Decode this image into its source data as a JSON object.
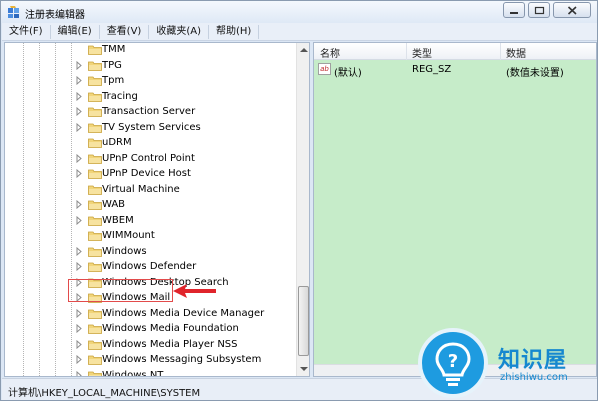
{
  "window": {
    "title": "注册表编辑器"
  },
  "menu": [
    "文件(F)",
    "编辑(E)",
    "查看(V)",
    "收藏夹(A)",
    "帮助(H)"
  ],
  "tree": {
    "items": [
      {
        "label": "TMM",
        "expander": false
      },
      {
        "label": "TPG",
        "expander": true
      },
      {
        "label": "Tpm",
        "expander": true
      },
      {
        "label": "Tracing",
        "expander": true
      },
      {
        "label": "Transaction Server",
        "expander": true
      },
      {
        "label": "TV System Services",
        "expander": true
      },
      {
        "label": "uDRM",
        "expander": false
      },
      {
        "label": "UPnP Control Point",
        "expander": true
      },
      {
        "label": "UPnP Device Host",
        "expander": true
      },
      {
        "label": "Virtual Machine",
        "expander": false
      },
      {
        "label": "WAB",
        "expander": true
      },
      {
        "label": "WBEM",
        "expander": true
      },
      {
        "label": "WIMMount",
        "expander": false
      },
      {
        "label": "Windows",
        "expander": true,
        "highlighted": true
      },
      {
        "label": "Windows Defender",
        "expander": true
      },
      {
        "label": "Windows Desktop Search",
        "expander": true
      },
      {
        "label": "Windows Mail",
        "expander": true
      },
      {
        "label": "Windows Media Device Manager",
        "expander": true
      },
      {
        "label": "Windows Media Foundation",
        "expander": true
      },
      {
        "label": "Windows Media Player NSS",
        "expander": true
      },
      {
        "label": "Windows Messaging Subsystem",
        "expander": true
      },
      {
        "label": "Windows NT",
        "expander": true
      }
    ]
  },
  "list": {
    "columns": [
      "名称",
      "类型",
      "数据"
    ],
    "rows": [
      {
        "name": "(默认)",
        "type": "REG_SZ",
        "data": "(数值未设置)",
        "icon": "ab"
      }
    ]
  },
  "status": {
    "path": "计算机\\HKEY_LOCAL_MACHINE\\SYSTEM"
  },
  "watermark": {
    "title": "知识屋",
    "subtitle": "zhishiwu.com"
  },
  "colors": {
    "list_background": "#c6ecc9",
    "highlight_border": "#e24b4b",
    "watermark_blue": "#1e9be0"
  }
}
